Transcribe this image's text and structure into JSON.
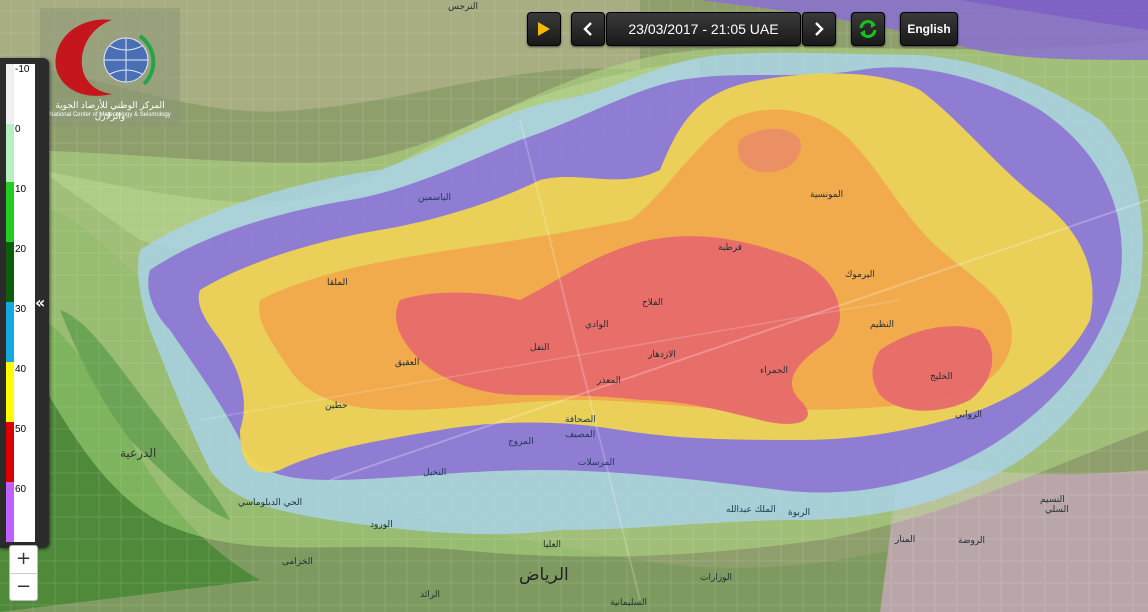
{
  "controls": {
    "datetime": "23/03/2017 - 21:05 UAE",
    "language_label": "English",
    "play_icon": "play-icon",
    "prev_icon": "chevron-left-icon",
    "next_icon": "chevron-right-icon",
    "refresh_icon": "refresh-icon",
    "collapse_icon": "double-chevron-left-icon",
    "zoom_in": "+",
    "zoom_out": "−"
  },
  "logo": {
    "arabic": "المركز الوطني للأرصاد الجوية والزلازل",
    "english": "National Center of Meteorology & Seismology"
  },
  "legend": {
    "labels": [
      "-10",
      "0",
      "10",
      "20",
      "30",
      "40",
      "50",
      "60"
    ],
    "colors": [
      "#f0f0f0",
      "#b7f0c0",
      "#22cc22",
      "#0b5e0b",
      "#16a8e0",
      "#ffff00",
      "#dd0000",
      "#c060ff"
    ]
  },
  "colors": {
    "purple": "#8a6fd0",
    "blue": "#a9cde6",
    "yellow": "#f3d64f",
    "orange": "#f2a24a",
    "red": "#e86a6a",
    "accent_green": "#19c11c",
    "play": "#f5b800"
  },
  "places": [
    "الرياض",
    "الدرعية",
    "المونسية",
    "قرطبة",
    "اليرموك",
    "الملقا",
    "الياسمين",
    "العقيق",
    "الوادي",
    "الفلاح",
    "النفل",
    "الازدهار",
    "المعذر",
    "حطين",
    "الحمراء",
    "الخليج",
    "الروابي",
    "النسيم",
    "النظيم",
    "الصحافة",
    "المروج",
    "النخيل",
    "المرسلات",
    "الربوة",
    "الملك عبدالله",
    "المصيف",
    "الوزارات",
    "النرجس",
    "الخزامى",
    "الحي الدبلوماسي",
    "العليا",
    "الروضة",
    "المنار",
    "السلي",
    "الرائد",
    "الورود",
    "السليمانية"
  ]
}
